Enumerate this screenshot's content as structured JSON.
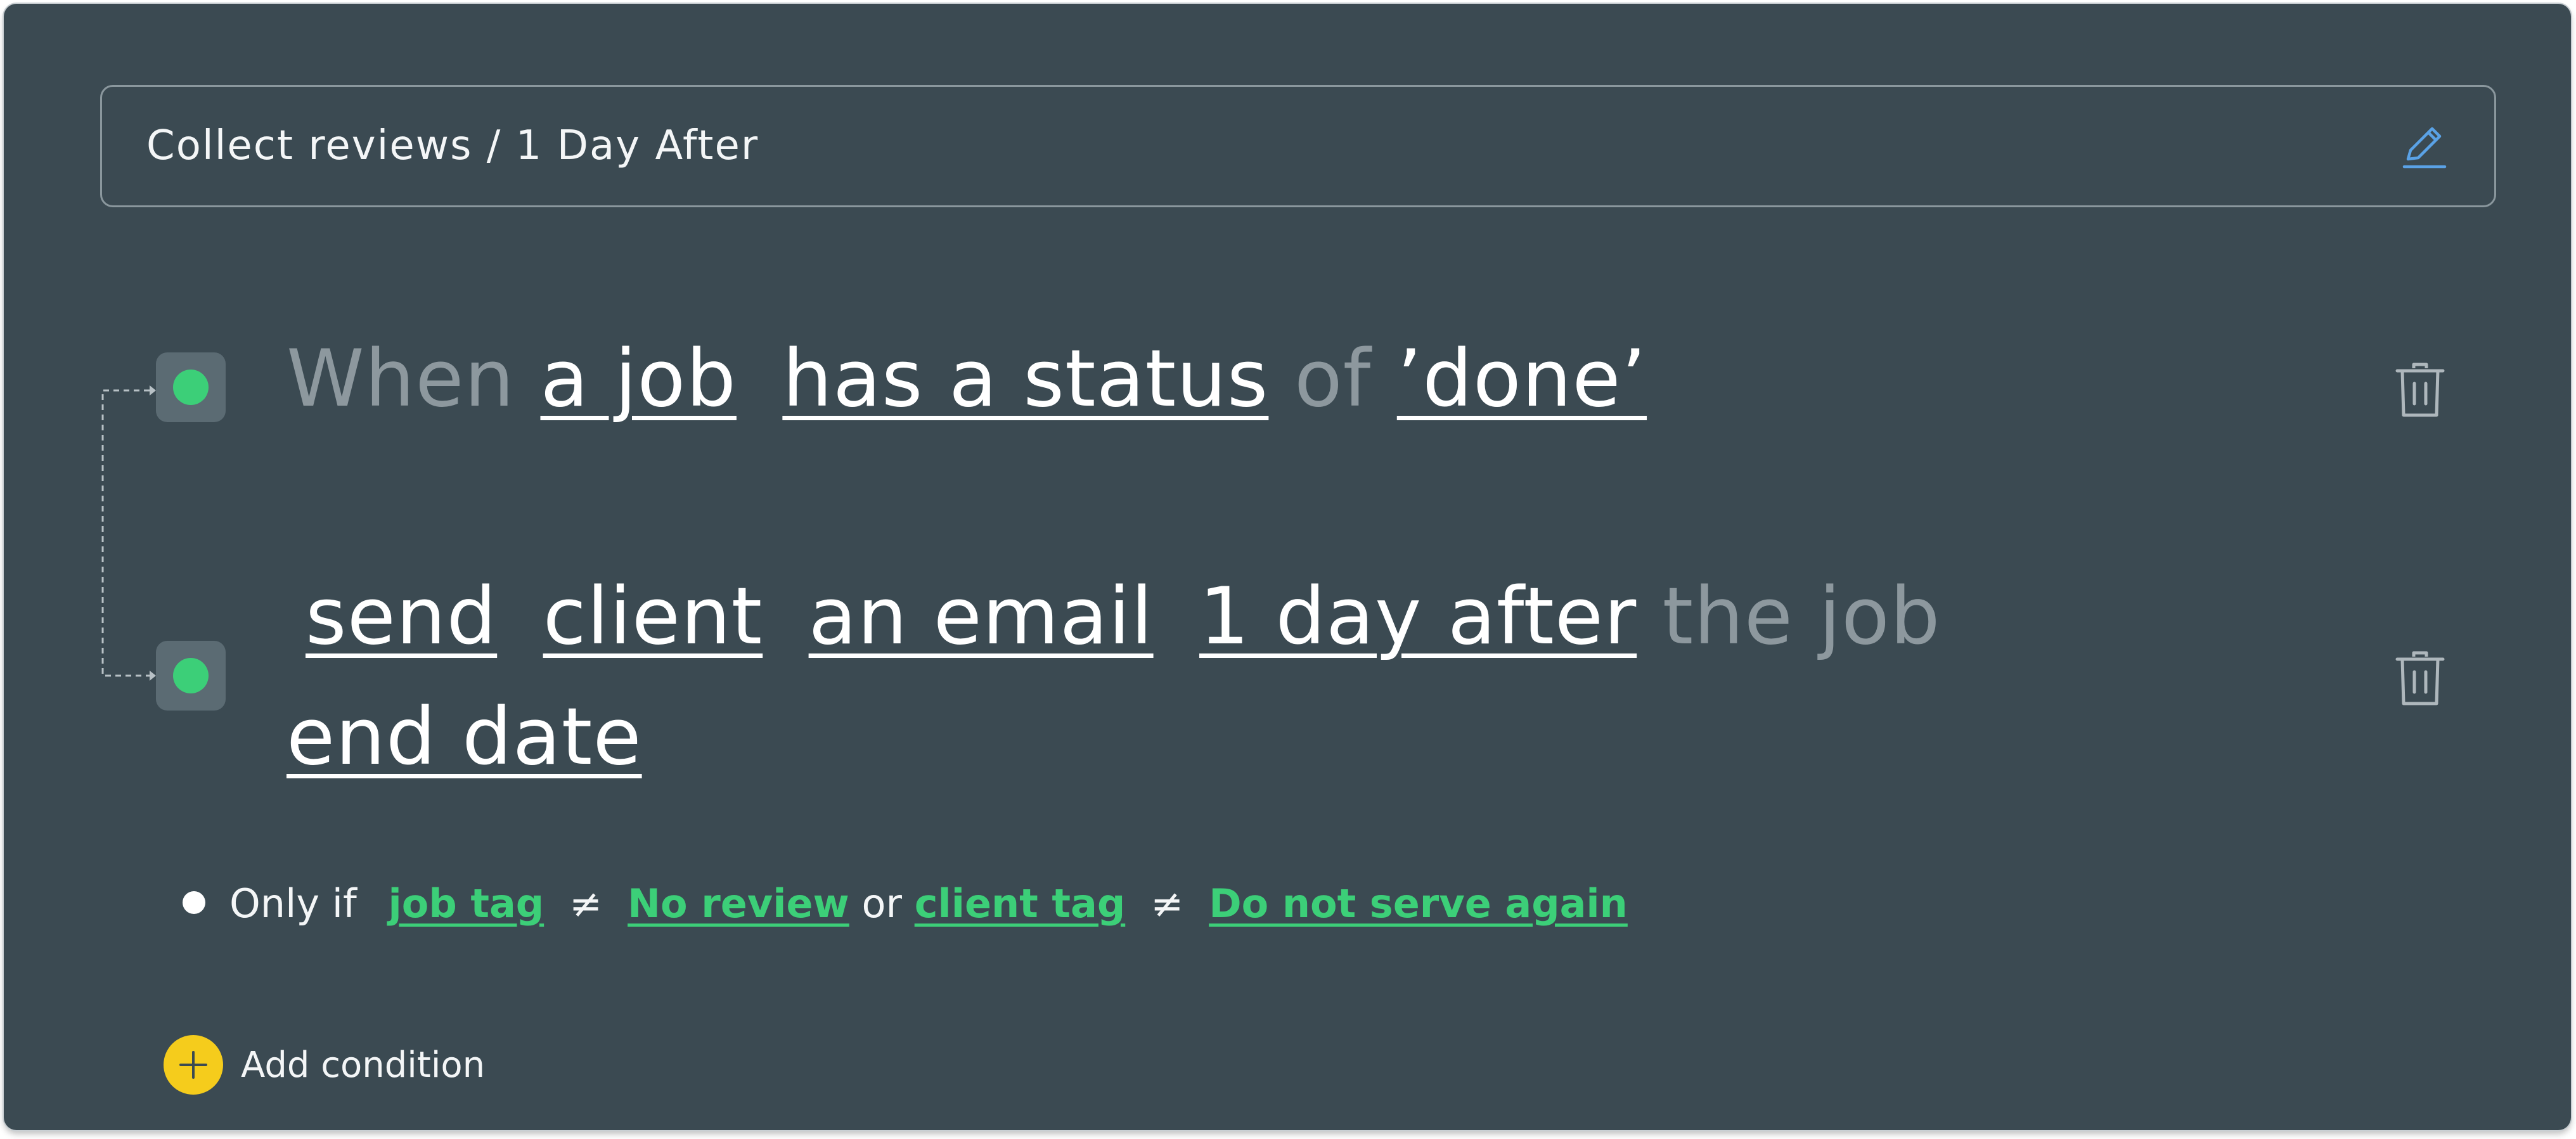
{
  "title_bar": {
    "text": "Collect reviews / 1 Day After",
    "edit_icon": "pencil-icon"
  },
  "trigger": {
    "when": "When",
    "subject": "a job",
    "verb": "has a status",
    "of": "of",
    "value": "’done’",
    "delete_icon": "trash-icon"
  },
  "action": {
    "action": "send",
    "recipient": "client",
    "channel": "an email",
    "timing": "1 day after",
    "the_job": "the job",
    "reference": "end date",
    "delete_icon": "trash-icon"
  },
  "condition": {
    "prefix": "Only if",
    "field1": "job tag",
    "op1": "≠",
    "value1": "No review",
    "joiner": "or",
    "field2": "client tag",
    "op2": "≠",
    "value2": "Do not serve again"
  },
  "add_condition": {
    "label": "Add condition",
    "icon": "plus-icon"
  },
  "colors": {
    "background": "#3b4a52",
    "accent_green": "#3ccf78",
    "add_button": "#f5cc1c",
    "edit_icon": "#5aa2e6",
    "muted_text": "#8d989e"
  }
}
